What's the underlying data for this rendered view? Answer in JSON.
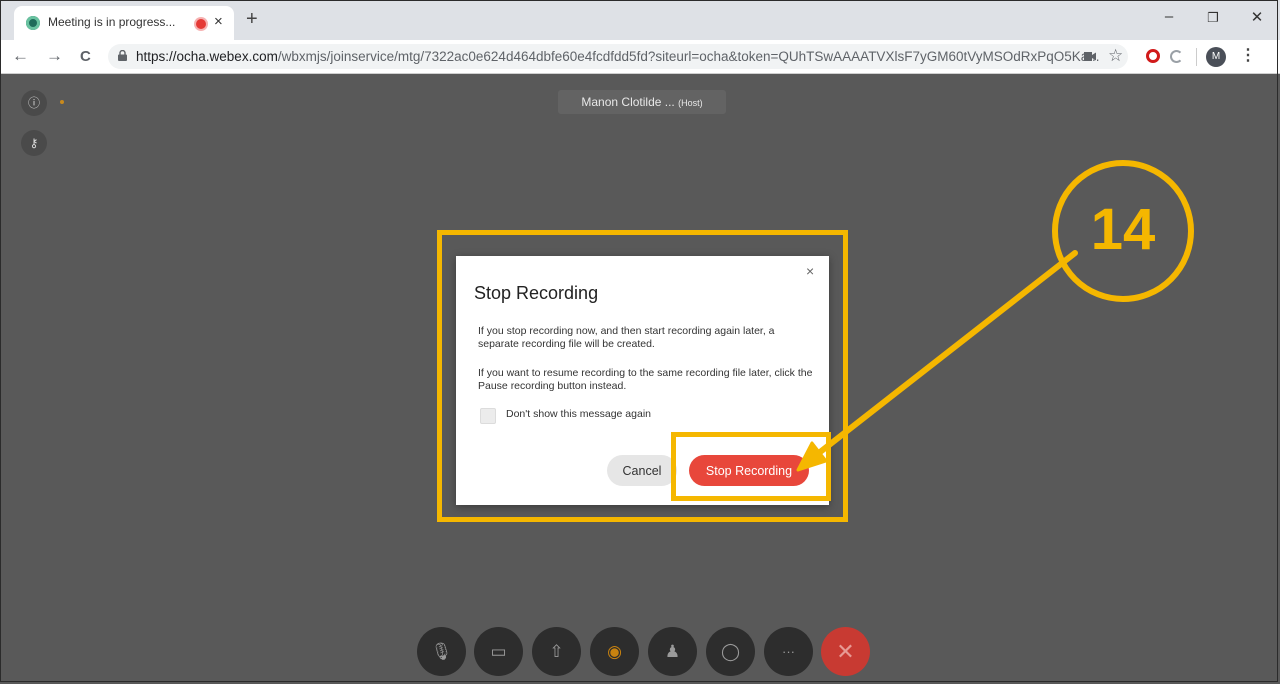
{
  "browser": {
    "tab_title": "Meeting is in progress...",
    "tab_close": "×",
    "new_tab": "+",
    "url_host": "https://ocha.webex.com",
    "url_path": "/wbxmjs/joinservice/mtg/7322ac0e624d464dbfe60e4fcdfdd5fd?siteurl=ocha&token=QUhTSwAAAATVXlsF7yGM60tVyMSOdRxPqO5Ka...",
    "avatar_letter": "M",
    "window_controls": [
      "–",
      "❐",
      "✕"
    ],
    "nav": [
      "←",
      "→",
      "C"
    ],
    "star": "☆",
    "menu": "⋮"
  },
  "meeting": {
    "host_name": "Manon Clotilde ...",
    "host_tag": "(Host)",
    "side_buttons": [
      "info-icon",
      "key-icon"
    ],
    "controls": [
      "mute-icon",
      "video-icon",
      "share-icon",
      "record-icon",
      "participants-icon",
      "chat-icon",
      "more-icon",
      "leave-icon"
    ],
    "control_glyphs": [
      "🎙",
      "▭",
      "⇧",
      "◉",
      "♟",
      "◯",
      "···",
      "✕"
    ]
  },
  "dialog": {
    "title": "Stop Recording",
    "close": "×",
    "para1": "If you stop recording now, and then start recording again later, a separate recording file will be created.",
    "para2": "If you want to resume recording to the same recording file later, click the Pause recording button instead.",
    "checkbox_label": "Don't show this message again",
    "cancel_label": "Cancel",
    "stop_label": "Stop Recording"
  },
  "annotation": {
    "step_number": "14",
    "color": "#f5b700"
  },
  "colors": {
    "meeting_bg": "#595959",
    "stop_button": "#e8473b",
    "leave_button": "#c83a32"
  }
}
